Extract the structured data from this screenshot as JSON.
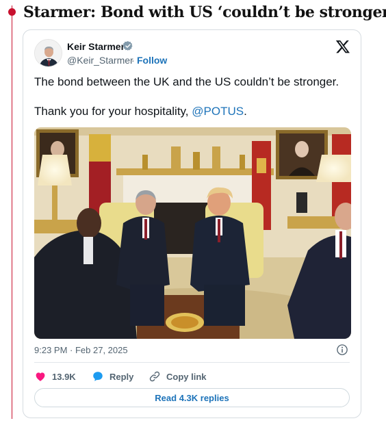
{
  "article": {
    "headline": "Starmer: Bond with US ‘couldn’t be stronger’"
  },
  "tweet": {
    "author": {
      "name": "Keir Starmer",
      "handle": "@Keir_Starmer",
      "separator": "·",
      "follow_label": "Follow",
      "verified": true
    },
    "text_line1": "The bond between the UK and the US couldn’t be stronger.",
    "text_line2_prefix": "Thank you for your hospitality, ",
    "mention": "@POTUS",
    "text_line2_suffix": ".",
    "timestamp": "9:23 PM · Feb 27, 2025",
    "actions": {
      "like_count": "13.9K",
      "reply_label": "Reply",
      "copy_link_label": "Copy link"
    },
    "read_replies_label": "Read 4.3K replies"
  },
  "icons": {
    "verified": "verified-badge-icon",
    "platform": "x-logo-icon",
    "info": "info-icon",
    "like": "heart-icon",
    "reply": "speech-bubble-icon",
    "copy_link": "link-icon"
  },
  "colors": {
    "accent_red": "#c8102e",
    "link_blue": "#1d73b9",
    "like_pink": "#f91880",
    "reply_blue": "#1d9bf0",
    "muted_text": "#536471"
  }
}
